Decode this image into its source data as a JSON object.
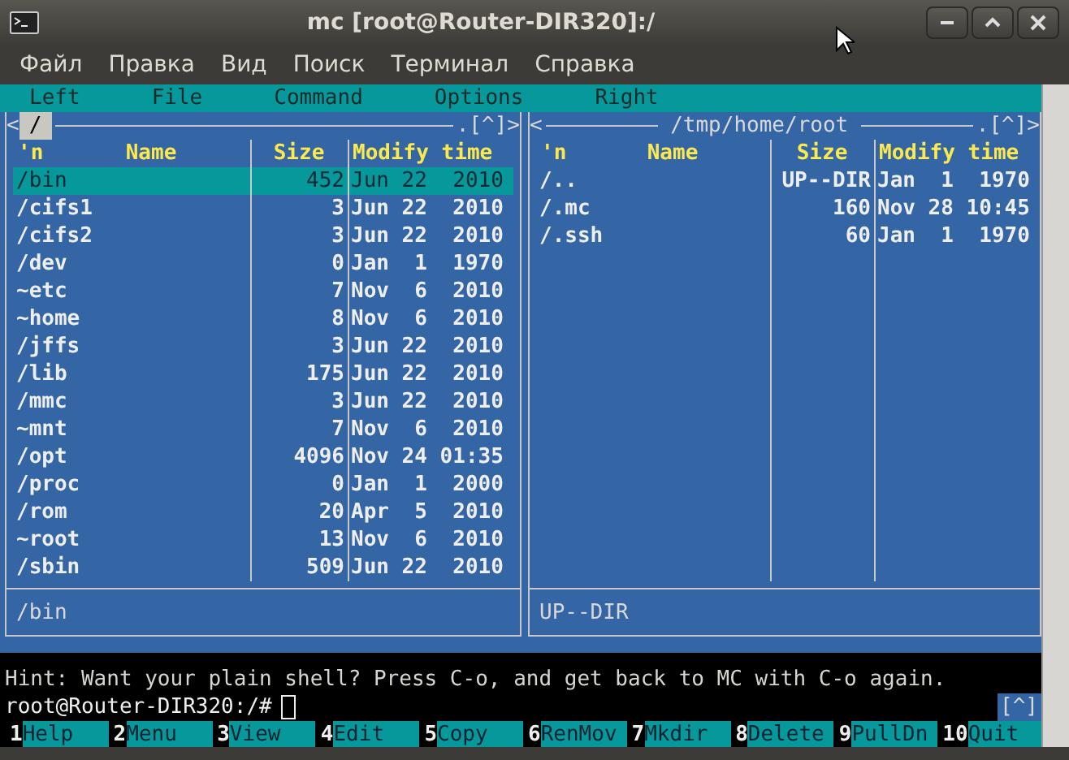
{
  "window": {
    "title": "mc [root@Router-DIR320]:/"
  },
  "menubar": [
    "Файл",
    "Правка",
    "Вид",
    "Поиск",
    "Терминал",
    "Справка"
  ],
  "mc_menu": [
    "Left",
    "File",
    "Command",
    "Options",
    "Right"
  ],
  "panels": [
    {
      "active": true,
      "history": "<",
      "path": "/",
      "corner": ".[^]>",
      "columns": [
        "'n",
        "Name",
        "Size",
        "Modify time"
      ],
      "status": "/bin",
      "rows": [
        {
          "name": "/bin",
          "size": "452",
          "modified": "Jun 22  2010",
          "selected": true
        },
        {
          "name": "/cifs1",
          "size": "3",
          "modified": "Jun 22  2010",
          "selected": false
        },
        {
          "name": "/cifs2",
          "size": "3",
          "modified": "Jun 22  2010",
          "selected": false
        },
        {
          "name": "/dev",
          "size": "0",
          "modified": "Jan  1  1970",
          "selected": false
        },
        {
          "name": "~etc",
          "size": "7",
          "modified": "Nov  6  2010",
          "selected": false
        },
        {
          "name": "~home",
          "size": "8",
          "modified": "Nov  6  2010",
          "selected": false
        },
        {
          "name": "/jffs",
          "size": "3",
          "modified": "Jun 22  2010",
          "selected": false
        },
        {
          "name": "/lib",
          "size": "175",
          "modified": "Jun 22  2010",
          "selected": false
        },
        {
          "name": "/mmc",
          "size": "3",
          "modified": "Jun 22  2010",
          "selected": false
        },
        {
          "name": "~mnt",
          "size": "7",
          "modified": "Nov  6  2010",
          "selected": false
        },
        {
          "name": "/opt",
          "size": "4096",
          "modified": "Nov 24 01:35",
          "selected": false
        },
        {
          "name": "/proc",
          "size": "0",
          "modified": "Jan  1  2000",
          "selected": false
        },
        {
          "name": "/rom",
          "size": "20",
          "modified": "Apr  5  2010",
          "selected": false
        },
        {
          "name": "~root",
          "size": "13",
          "modified": "Nov  6  2010",
          "selected": false
        },
        {
          "name": "/sbin",
          "size": "509",
          "modified": "Jun 22  2010",
          "selected": false
        }
      ]
    },
    {
      "active": false,
      "history": "<",
      "path": "/tmp/home/root",
      "corner": ".[^]>",
      "columns": [
        "'n",
        "Name",
        "Size",
        "Modify time"
      ],
      "status": "UP--DIR",
      "rows": [
        {
          "name": "/..",
          "size": "UP--DIR",
          "modified": "Jan  1  1970",
          "selected": false
        },
        {
          "name": "/.mc",
          "size": "160",
          "modified": "Nov 28 10:45",
          "selected": false
        },
        {
          "name": "/.ssh",
          "size": "60",
          "modified": "Jan  1  1970",
          "selected": false
        }
      ]
    }
  ],
  "hint": "Hint: Want your plain shell? Press C-o, and get back to MC with C-o again.",
  "prompt": "root@Router-DIR320:/#",
  "prompt_corner": "[^]",
  "function_keys": [
    {
      "number": "1",
      "label": "Help"
    },
    {
      "number": "2",
      "label": "Menu"
    },
    {
      "number": "3",
      "label": "View"
    },
    {
      "number": "4",
      "label": "Edit"
    },
    {
      "number": "5",
      "label": "Copy"
    },
    {
      "number": "6",
      "label": "RenMov"
    },
    {
      "number": "7",
      "label": "Mkdir"
    },
    {
      "number": "8",
      "label": "Delete"
    },
    {
      "number": "9",
      "label": "PullDn"
    },
    {
      "number": "10",
      "label": "Quit"
    }
  ]
}
